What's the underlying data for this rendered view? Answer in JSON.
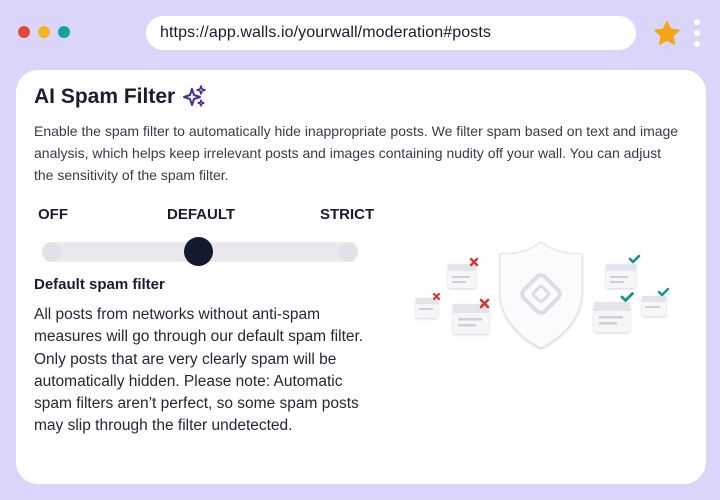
{
  "browser": {
    "url": "https://app.walls.io/yourwall/moderation#posts"
  },
  "card": {
    "title": "AI Spam Filter",
    "description": "Enable the spam filter to automatically hide inappropriate posts. We filter spam based on text and image analysis, which helps keep irrelevant posts and images containing nudity off your wall. You can adjust the sensitivity of the spam filter.",
    "slider": {
      "labels": [
        "OFF",
        "DEFAULT",
        "STRICT"
      ],
      "selected": "DEFAULT"
    },
    "subheading": "Default spam filter",
    "body": "All posts from networks without anti-spam measures will go through our default spam filter. Only posts that are very clearly spam will be automatically hidden. Please note: Automatic spam filters aren’t perfect, so some spam posts may slip through the filter undetected."
  },
  "colors": {
    "background": "#d9d6fa",
    "accent_star": "#f2a516",
    "sparkle": "#4c2a96",
    "reject": "#d8342b",
    "approve": "#14948c",
    "slider_thumb": "#131a2c"
  },
  "icons": [
    "star-icon",
    "kebab-menu-icon",
    "sparkle-icon",
    "shield-icon"
  ]
}
